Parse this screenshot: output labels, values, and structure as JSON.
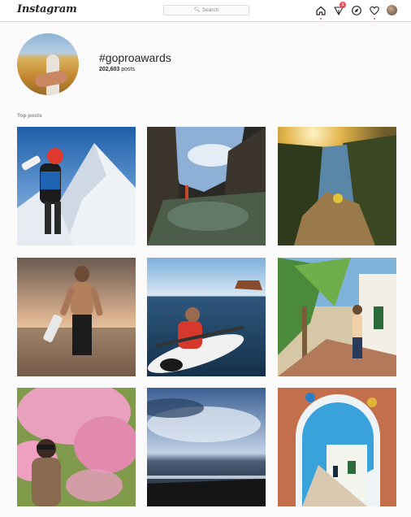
{
  "header": {
    "logo_text": "Instagram",
    "search_placeholder": "Search",
    "notification_count": "1",
    "icons": [
      "home-icon",
      "activity-icon",
      "explore-icon",
      "heart-icon"
    ]
  },
  "tag": {
    "name": "#goproawards",
    "post_count": "202,603",
    "post_count_label": "posts"
  },
  "section": {
    "top_posts_label": "Top posts"
  },
  "posts": [
    {
      "subject": "skier selfie on snowy ridge",
      "colors": [
        "#2f6fb3",
        "#dfe8f0"
      ]
    },
    {
      "subject": "sea cave tide pool",
      "colors": [
        "#6c8db8",
        "#2d2a24"
      ]
    },
    {
      "subject": "river canyon at sunrise",
      "colors": [
        "#e3b648",
        "#3e4a24"
      ]
    },
    {
      "subject": "shirtless man at beach sunset",
      "colors": [
        "#b87f5a",
        "#4e3b2b"
      ]
    },
    {
      "subject": "kayaker on the ocean",
      "colors": [
        "#89b3d8",
        "#1e3d59"
      ]
    },
    {
      "subject": "woman on flowered village street",
      "colors": [
        "#4b8a3a",
        "#d8c7a8"
      ]
    },
    {
      "subject": "woman under cherry blossoms",
      "colors": [
        "#e79ab8",
        "#5f7a3a"
      ]
    },
    {
      "subject": "stormy ocean sky",
      "colors": [
        "#4a6a9a",
        "#1b2430"
      ]
    },
    {
      "subject": "archway onto white village street",
      "colors": [
        "#3a9fd6",
        "#c1704e"
      ]
    }
  ],
  "accent": "#ed4956"
}
